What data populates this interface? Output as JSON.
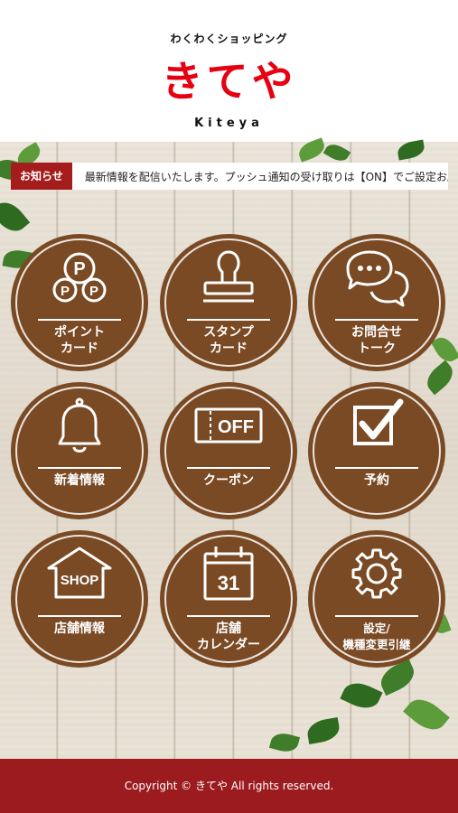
{
  "header": {
    "tagline": "わくわくショッピング",
    "logo": "きてや",
    "logo_sub": "Kiteya"
  },
  "news": {
    "label": "お知らせ",
    "text": "最新情報を配信いたします。プッシュ通知の受け取りは【ON】でご設定お願いします。"
  },
  "menu": [
    {
      "label": "ポイント\nカード",
      "icon": "point-card-icon"
    },
    {
      "label": "スタンプ\nカード",
      "icon": "stamp-icon"
    },
    {
      "label": "お問合せ\nトーク",
      "icon": "chat-bubbles-icon"
    },
    {
      "label": "新着情報",
      "icon": "bell-icon"
    },
    {
      "label": "クーポン",
      "icon": "coupon-icon",
      "icon_text": "OFF"
    },
    {
      "label": "予約",
      "icon": "checkbox-icon"
    },
    {
      "label": "店舗情報",
      "icon": "shop-icon",
      "icon_text": "SHOP"
    },
    {
      "label": "店舗\nカレンダー",
      "icon": "calendar-icon",
      "icon_text": "31"
    },
    {
      "label": "設定/\n機種変更引継",
      "icon": "gear-icon"
    }
  ],
  "footer": {
    "copyright": "Copyright © きてや All rights reserved."
  },
  "colors": {
    "brand_red": "#e60012",
    "tile_brown": "#7a4a24",
    "footer_red": "#9c1b1f"
  }
}
